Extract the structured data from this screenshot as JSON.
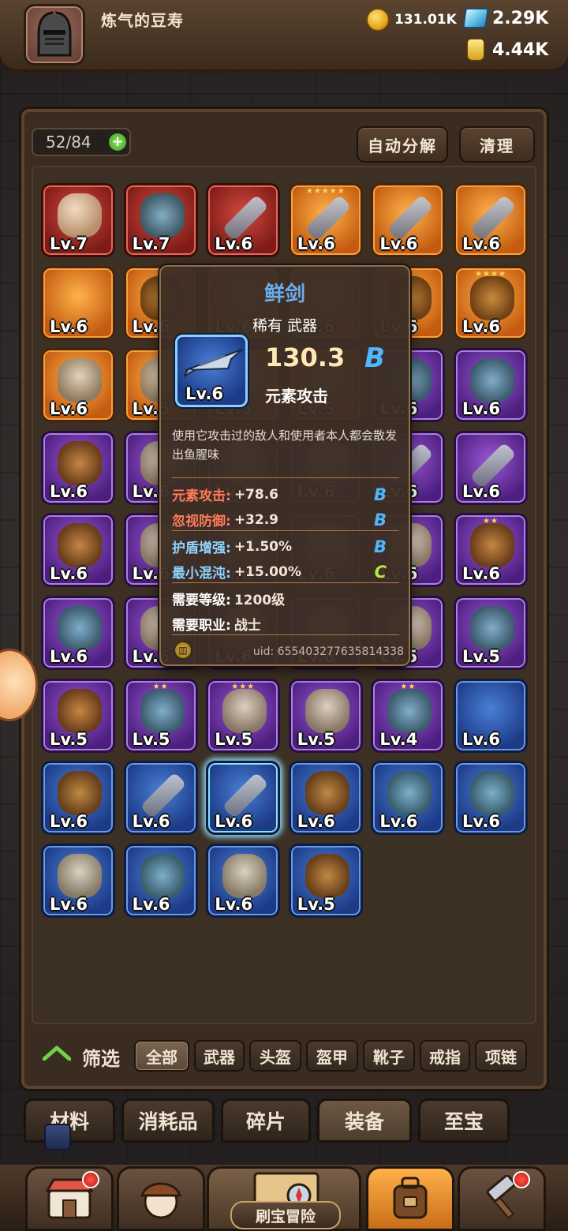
{
  "header": {
    "player_name": "炼气的豆寿",
    "gold": "131.01K",
    "gems": "2.29K",
    "potion": "4.44K"
  },
  "inventory": {
    "capacity": "52/84",
    "add_icon": "+",
    "auto_decompose_label": "自动分解",
    "clear_label": "清理",
    "slots": [
      {
        "lv": "Lv.7",
        "rarity": "red",
        "icon": "mug-icon"
      },
      {
        "lv": "Lv.7",
        "rarity": "red",
        "icon": "helmet-icon"
      },
      {
        "lv": "Lv.6",
        "rarity": "red",
        "icon": "sword-icon"
      },
      {
        "lv": "Lv.6",
        "rarity": "orange",
        "icon": "bat-icon",
        "stars": "★★★★★"
      },
      {
        "lv": "Lv.6",
        "rarity": "orange",
        "icon": "bat-icon"
      },
      {
        "lv": "Lv.6",
        "rarity": "orange",
        "icon": "sword-icon"
      },
      {
        "lv": "Lv.6",
        "rarity": "orange",
        "icon": "blank"
      },
      {
        "lv": "Lv.6",
        "rarity": "orange",
        "icon": "axe-icon"
      },
      {
        "lv": "Lv.6",
        "rarity": "orange",
        "icon": "item-icon"
      },
      {
        "lv": "Lv.6",
        "rarity": "orange",
        "icon": "item-icon"
      },
      {
        "lv": "Lv.6",
        "rarity": "orange",
        "icon": "armor-icon",
        "stars": "★"
      },
      {
        "lv": "Lv.6",
        "rarity": "orange",
        "icon": "armor-icon",
        "stars": "★★★★"
      },
      {
        "lv": "Lv.6",
        "rarity": "orange",
        "icon": "bracelet-icon"
      },
      {
        "lv": "Lv.5",
        "rarity": "orange",
        "icon": "item-icon"
      },
      {
        "lv": "Lv.5",
        "rarity": "orange",
        "icon": "item-icon"
      },
      {
        "lv": "Lv.5",
        "rarity": "orange",
        "icon": "item-icon"
      },
      {
        "lv": "Lv.6",
        "rarity": "purple",
        "icon": "shield-icon"
      },
      {
        "lv": "Lv.6",
        "rarity": "purple",
        "icon": "shield-icon"
      },
      {
        "lv": "Lv.6",
        "rarity": "purple",
        "icon": "meat-icon"
      },
      {
        "lv": "Lv.6",
        "rarity": "purple",
        "icon": "item-icon"
      },
      {
        "lv": "Lv.6",
        "rarity": "purple",
        "icon": "item-icon"
      },
      {
        "lv": "Lv.6",
        "rarity": "purple",
        "icon": "item-icon"
      },
      {
        "lv": "Lv.6",
        "rarity": "purple",
        "icon": "sword-icon"
      },
      {
        "lv": "Lv.6",
        "rarity": "purple",
        "icon": "sword-icon"
      },
      {
        "lv": "Lv.6",
        "rarity": "purple",
        "icon": "gun-icon"
      },
      {
        "lv": "Lv.6",
        "rarity": "purple",
        "icon": "item-icon"
      },
      {
        "lv": "Lv.6",
        "rarity": "purple",
        "icon": "item-icon"
      },
      {
        "lv": "Lv.6",
        "rarity": "purple",
        "icon": "item-icon"
      },
      {
        "lv": "Lv.6",
        "rarity": "purple",
        "icon": "item-icon"
      },
      {
        "lv": "Lv.6",
        "rarity": "purple",
        "icon": "armor-icon",
        "stars": "★★"
      },
      {
        "lv": "Lv.6",
        "rarity": "purple",
        "icon": "helmet-icon"
      },
      {
        "lv": "Lv.6",
        "rarity": "purple",
        "icon": "item-icon"
      },
      {
        "lv": "Lv.6",
        "rarity": "purple",
        "icon": "item-icon"
      },
      {
        "lv": "Lv.6",
        "rarity": "purple",
        "icon": "item-icon"
      },
      {
        "lv": "Lv.5",
        "rarity": "purple",
        "icon": "item-icon"
      },
      {
        "lv": "Lv.5",
        "rarity": "purple",
        "icon": "spiral-icon"
      },
      {
        "lv": "Lv.5",
        "rarity": "purple",
        "icon": "wand-icon"
      },
      {
        "lv": "Lv.5",
        "rarity": "purple",
        "icon": "helmet-icon",
        "stars": "★★"
      },
      {
        "lv": "Lv.5",
        "rarity": "purple",
        "icon": "necklace-icon",
        "stars": "★★★"
      },
      {
        "lv": "Lv.5",
        "rarity": "purple",
        "icon": "necklace-icon"
      },
      {
        "lv": "Lv.4",
        "rarity": "purple",
        "icon": "helmet-icon",
        "stars": "★★"
      },
      {
        "lv": "Lv.6",
        "rarity": "blue",
        "icon": "blank"
      },
      {
        "lv": "Lv.6",
        "rarity": "blue",
        "icon": "pizza-icon"
      },
      {
        "lv": "Lv.6",
        "rarity": "blue",
        "icon": "sword-icon"
      },
      {
        "lv": "Lv.6",
        "rarity": "blue",
        "icon": "fish-sword-icon",
        "selected": true
      },
      {
        "lv": "Lv.6",
        "rarity": "blue",
        "icon": "wand-icon"
      },
      {
        "lv": "Lv.6",
        "rarity": "blue",
        "icon": "helmet-icon"
      },
      {
        "lv": "Lv.6",
        "rarity": "blue",
        "icon": "crown-icon"
      },
      {
        "lv": "Lv.6",
        "rarity": "blue",
        "icon": "cat-mask-icon"
      },
      {
        "lv": "Lv.6",
        "rarity": "blue",
        "icon": "helmet-icon"
      },
      {
        "lv": "Lv.6",
        "rarity": "blue",
        "icon": "bracelet-icon"
      },
      {
        "lv": "Lv.5",
        "rarity": "blue",
        "icon": "armor-icon"
      }
    ]
  },
  "tooltip": {
    "name": "鲜剑",
    "type": "稀有 武器",
    "level": "Lv.6",
    "value": "130.3",
    "grade": "B",
    "main_stat": "元素攻击",
    "description": "使用它攻击过的敌人和使用者本人都会散发出鱼腥味",
    "stats": [
      {
        "key": "元素攻击:",
        "val": "+78.6",
        "grade": "B",
        "color": "red"
      },
      {
        "key": "忽视防御:",
        "val": "+32.9",
        "grade": "B",
        "color": "red"
      },
      {
        "key": "护盾增强:",
        "val": "+1.50%",
        "grade": "B",
        "color": "blue"
      },
      {
        "key": "最小混沌:",
        "val": "+15.00%",
        "grade": "C",
        "color": "blue"
      }
    ],
    "req_level_key": "需要等级:",
    "req_level": "1200级",
    "req_class_key": "需要职业:",
    "req_class": "战士",
    "uid": "uid: 655403277635814338"
  },
  "filter": {
    "label": "筛选",
    "options": [
      "全部",
      "武器",
      "头盔",
      "盔甲",
      "靴子",
      "戒指",
      "项链"
    ]
  },
  "categories": [
    "材料",
    "消耗品",
    "碎片",
    "装备",
    "至宝"
  ],
  "bottom_nav": {
    "center_label": "刷宝冒险"
  },
  "colors": {
    "rarity_red": "#a92a22",
    "rarity_orange": "#e07a1f",
    "rarity_purple": "#6e34a8",
    "rarity_blue": "#2a55b0",
    "grade_b": "#4fb7ff",
    "grade_c": "#b8e83a",
    "tooltip_name": "#6aaef2"
  }
}
